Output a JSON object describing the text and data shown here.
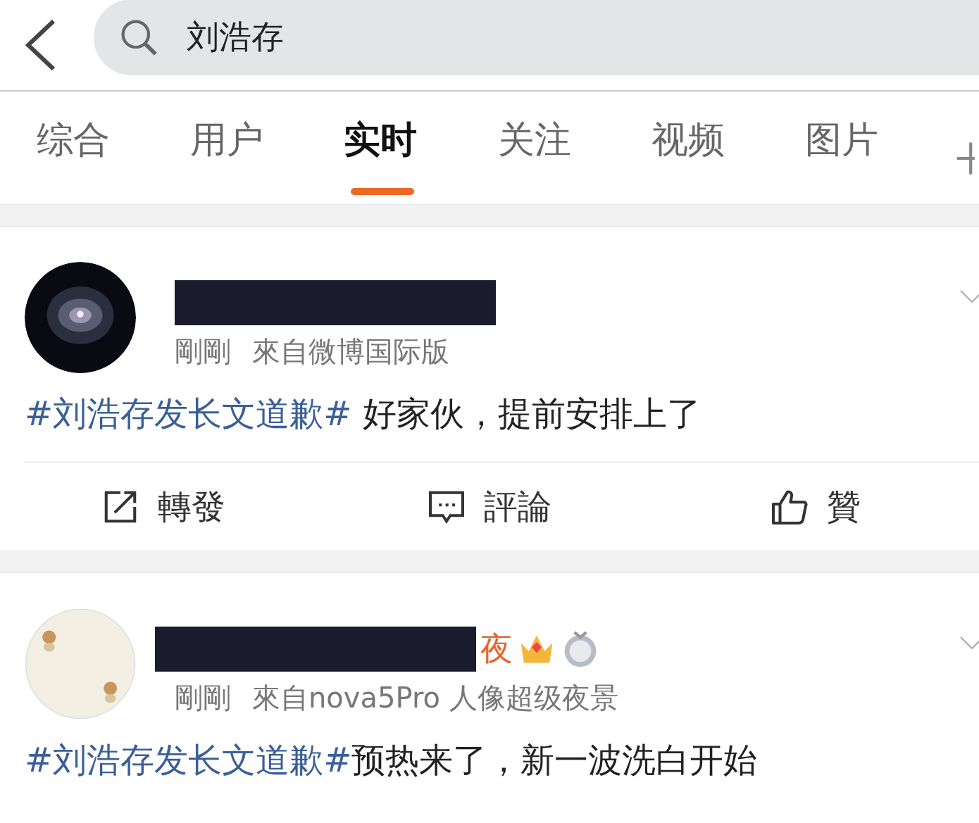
{
  "search": {
    "value": "刘浩存"
  },
  "tabs": [
    {
      "label": "综合",
      "selected": false
    },
    {
      "label": "用户",
      "selected": false
    },
    {
      "label": "实时",
      "selected": true
    },
    {
      "label": "关注",
      "selected": false
    },
    {
      "label": "视频",
      "selected": false
    },
    {
      "label": "图片",
      "selected": false
    }
  ],
  "posts": [
    {
      "time": "剛剛",
      "source": "來自微博国际版",
      "hashtag": "#刘浩存发长文道歉#",
      "text": " 好家伙，提前安排上了",
      "actions": [
        "轉發",
        "評論",
        "贊"
      ]
    },
    {
      "name_visible": "夜",
      "time": "剛剛",
      "source": "來自nova5Pro 人像超级夜景",
      "hashtag": "#刘浩存发长文道歉#",
      "text": "预热来了，新一波洗白开始"
    }
  ]
}
